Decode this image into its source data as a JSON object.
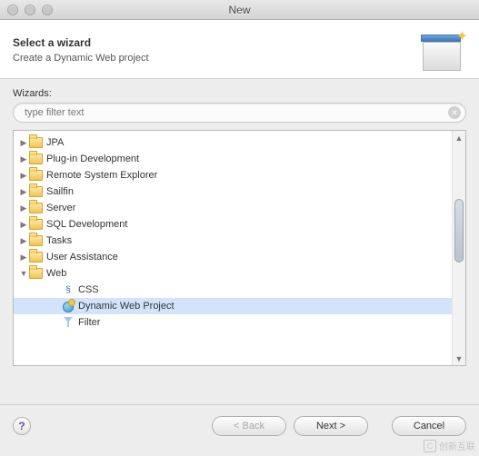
{
  "titlebar": {
    "title": "New"
  },
  "header": {
    "heading": "Select a wizard",
    "subheading": "Create a Dynamic Web project"
  },
  "filter": {
    "label": "Wizards:",
    "placeholder": "type filter text"
  },
  "tree": {
    "items": [
      {
        "label": "JPA",
        "expanded": false,
        "level": 0,
        "type": "folder"
      },
      {
        "label": "Plug-in Development",
        "expanded": false,
        "level": 0,
        "type": "folder"
      },
      {
        "label": "Remote System Explorer",
        "expanded": false,
        "level": 0,
        "type": "folder"
      },
      {
        "label": "Sailfin",
        "expanded": false,
        "level": 0,
        "type": "folder"
      },
      {
        "label": "Server",
        "expanded": false,
        "level": 0,
        "type": "folder"
      },
      {
        "label": "SQL Development",
        "expanded": false,
        "level": 0,
        "type": "folder"
      },
      {
        "label": "Tasks",
        "expanded": false,
        "level": 0,
        "type": "folder"
      },
      {
        "label": "User Assistance",
        "expanded": false,
        "level": 0,
        "type": "folder"
      },
      {
        "label": "Web",
        "expanded": true,
        "level": 0,
        "type": "folder"
      },
      {
        "label": "CSS",
        "level": 1,
        "type": "leaf",
        "icon": "css"
      },
      {
        "label": "Dynamic Web Project",
        "level": 1,
        "type": "leaf",
        "icon": "dwp",
        "selected": true
      },
      {
        "label": "Filter",
        "level": 1,
        "type": "leaf",
        "icon": "filter"
      }
    ]
  },
  "buttons": {
    "back": "< Back",
    "next": "Next >",
    "cancel": "Cancel"
  },
  "watermark": "创新互联"
}
